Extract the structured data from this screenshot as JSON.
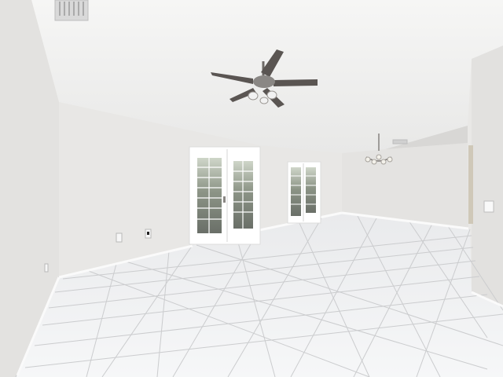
{
  "scene": {
    "description_hidden": "",
    "colors": {
      "ceiling": "#f3f3f2",
      "wall": "#e6e5e3",
      "wall_shadow": "#d6d5d3",
      "floor": "#f4f5f6",
      "grout": "#c9cacc",
      "baseboard": "#fafafa",
      "door_frame": "#ffffff",
      "glass": "#6f756f",
      "fan_blade": "#5a5552",
      "fixture_metal": "#8a8784"
    }
  }
}
